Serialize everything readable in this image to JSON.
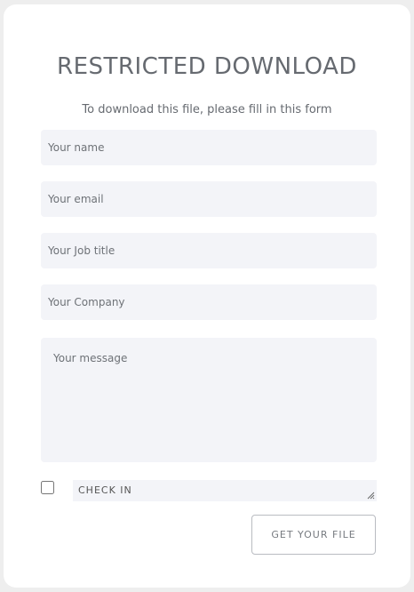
{
  "form": {
    "title": "RESTRICTED DOWNLOAD",
    "subtitle": "To download this file, please fill in this form",
    "name_placeholder": "Your name",
    "email_placeholder": "Your email",
    "job_placeholder": "Your Job title",
    "company_placeholder": "Your Company",
    "message_placeholder": "Your message",
    "checkin_label": "CHECK IN",
    "submit_label": "GET YOUR FILE"
  },
  "icons": {
    "resize": "resize-grip-icon"
  }
}
